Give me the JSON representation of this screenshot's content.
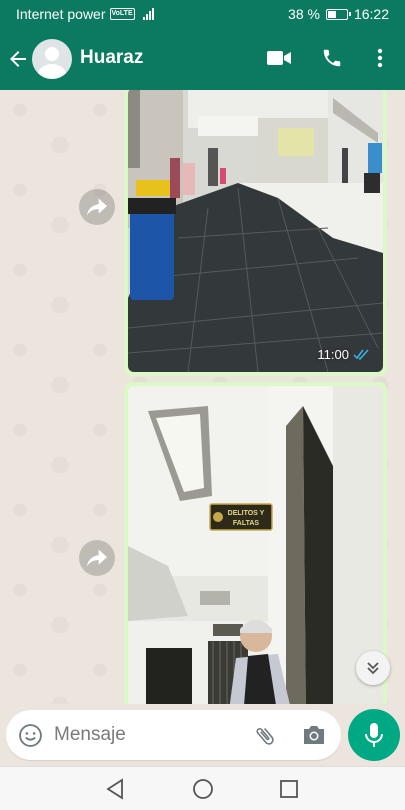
{
  "status_bar": {
    "carrier": "Internet power",
    "network_badge": "VoLTE",
    "battery_text": "38 %",
    "battery_level": 0.38,
    "time": "16:22"
  },
  "header": {
    "contact_name": "Huaraz",
    "icons": [
      "back-arrow-icon",
      "avatar-placeholder",
      "video-call-icon",
      "phone-icon",
      "more-options-icon"
    ]
  },
  "messages": [
    {
      "type": "image",
      "description_icon": "photo",
      "time": "11:00",
      "status": "read"
    },
    {
      "type": "image",
      "description_icon": "photo",
      "sign_text": "DELITOS Y FALTAS"
    }
  ],
  "input": {
    "placeholder": "Mensaje",
    "icons": [
      "emoji-icon",
      "attach-icon",
      "camera-icon",
      "mic-icon"
    ]
  },
  "colors": {
    "header": "#0b7a61",
    "accent": "#00a884",
    "bubble_outgoing": "#dcf8c6",
    "chat_background": "#ece5dd",
    "read_ticks": "#34b7f1"
  }
}
